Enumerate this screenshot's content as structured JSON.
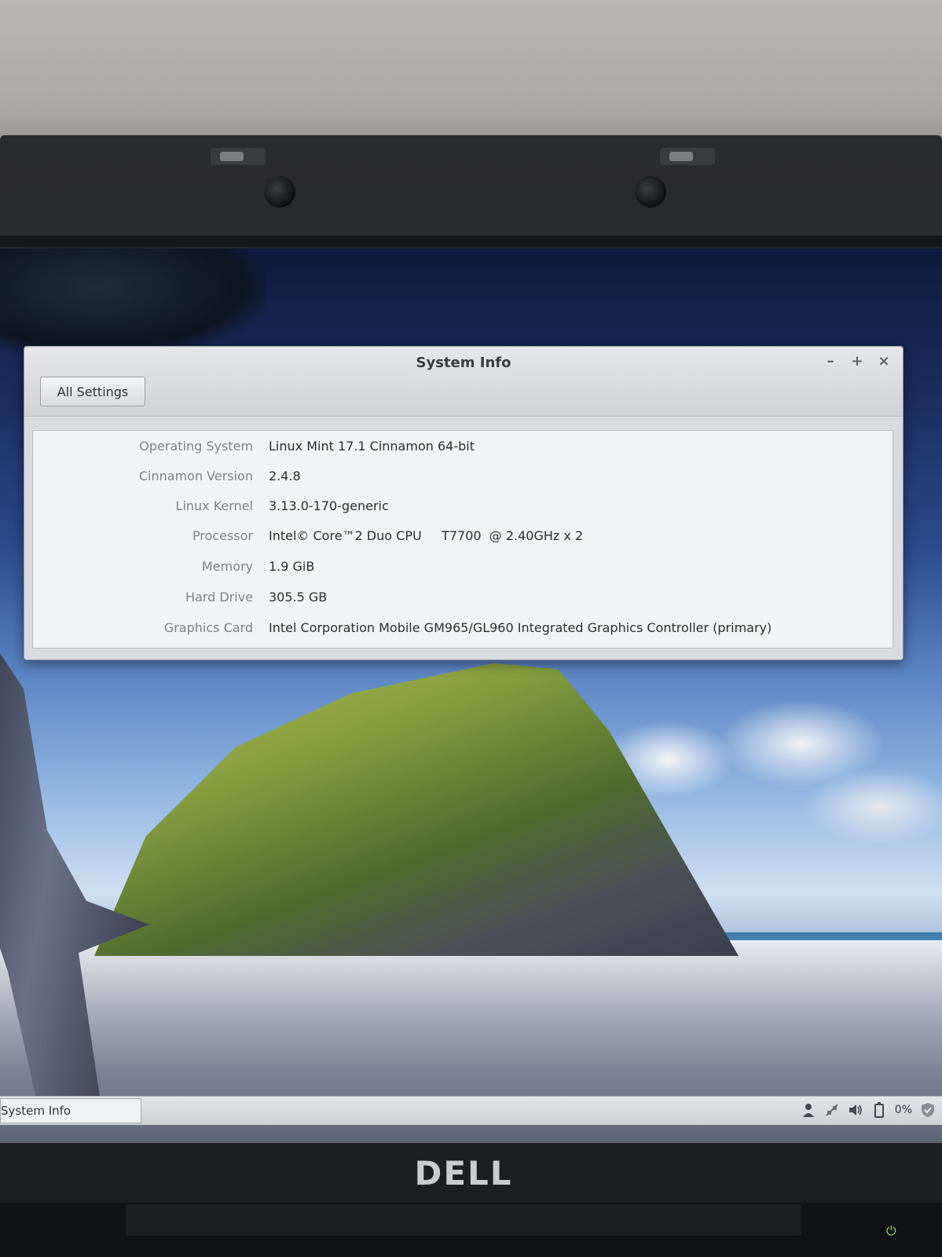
{
  "window": {
    "title": "System Info",
    "controls": {
      "minimize": "–",
      "maximize": "+",
      "close": "×"
    },
    "all_settings_label": "All Settings"
  },
  "info": [
    {
      "label": "Operating System",
      "value": "Linux Mint 17.1 Cinnamon 64-bit"
    },
    {
      "label": "Cinnamon Version",
      "value": "2.4.8"
    },
    {
      "label": "Linux Kernel",
      "value": "3.13.0-170-generic"
    },
    {
      "label": "Processor",
      "value": "Intel© Core™2 Duo CPU     T7700  @ 2.40GHz x 2"
    },
    {
      "label": "Memory",
      "value": "1.9 GiB"
    },
    {
      "label": "Hard Drive",
      "value": "305.5 GB"
    },
    {
      "label": "Graphics Card",
      "value": "Intel Corporation Mobile GM965/GL960 Integrated Graphics Controller (primary)"
    }
  ],
  "taskbar": {
    "task_label": "System Info",
    "tray": {
      "battery_text": "0%",
      "icons": [
        "user-icon",
        "network-icon",
        "volume-icon",
        "battery-icon",
        "shield-icon"
      ]
    }
  },
  "hardware": {
    "brand": "DELL"
  }
}
